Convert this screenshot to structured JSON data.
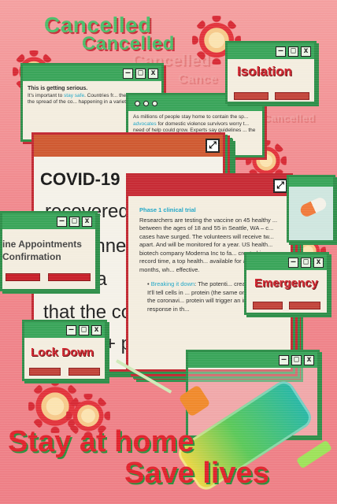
{
  "cancelled_words": [
    "Cancelled",
    "Cancelled",
    "Cancelled",
    "Cance",
    "Cancelled"
  ],
  "window_serious": {
    "heading": "This is getting serious.",
    "body_pre": "It's important to ",
    "body_link": "stay safe",
    "body_post": ". Countries fr... their part to stop the spread of the co... happening in a variety of areas..."
  },
  "window_violence": {
    "body_pre": "As millions of people stay home to contain the sp... ",
    "body_link": "advocates",
    "body_post": " for domestic violence survivors worry t... need of help could grow. Experts say guidelines ... the pandemic p..."
  },
  "window_isolation": {
    "label": "Isolation"
  },
  "window_covid": {
    "heading": "COVID-19",
    "big_lines": [
      "recovered f",
      "anne",
      "en a",
      "that the co",
      "+ p"
    ]
  },
  "window_trial": {
    "heading": "Phase 1 clinical trial",
    "body": "Researchers are testing the vaccine on 45 healthy ... between the ages of 18 and 55 in Seattle, WA – c... cases have surged. The volunteers will receive tw... apart. And will be monitored for a year. US health... biotech company Moderna Inc to fa... created in record time, a top health... available for at least 12 months, wh... effective.",
    "bullet_link": "Breaking it down",
    "bullet_body": ": The potenti... created in a lab. It'll tell cells in ... protein (the same one found in the coronavi... protein will trigger an immune response in th..."
  },
  "window_appointments": {
    "line1": "ine Appointments",
    "line2": "Confirmation"
  },
  "window_emergency": {
    "label": "Emergency"
  },
  "window_lockdown": {
    "label": "Lock Down"
  },
  "slogan": {
    "line1": "Stay at home",
    "line2": "Save lives"
  },
  "titlebar_buttons": {
    "min": "–",
    "max": "□",
    "close": "x"
  },
  "expand_glyph": "⤢",
  "colors": {
    "red": "#c72b35",
    "green": "#3aa55a",
    "bg": "#f0878c"
  }
}
